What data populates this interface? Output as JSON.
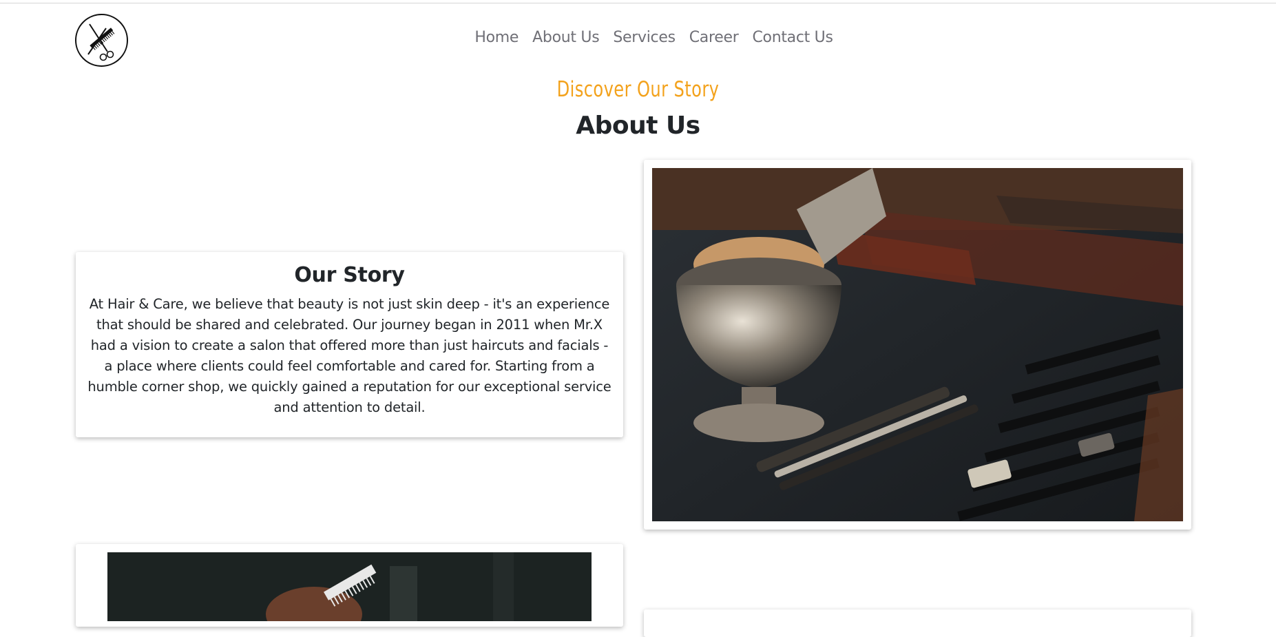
{
  "nav": {
    "items": [
      "Home",
      "About Us",
      "Services",
      "Career",
      "Contact Us"
    ]
  },
  "header": {
    "eyebrow": "Discover Our Story",
    "title": "About Us"
  },
  "story": {
    "heading": "Our Story",
    "body": "At Hair & Care, we believe that beauty is not just skin deep - it's an experience that should be shared and celebrated. Our journey began in 2011 when Mr.X had a vision to create a salon that offered more than just haircuts and facials - a place where clients could feel comfortable and cared for. Starting from a humble corner shop, we quickly gained a reputation for our exceptional service and attention to detail."
  },
  "colors": {
    "accent": "#f3a21c",
    "nav_text": "#6f6f76",
    "heading": "#212529"
  },
  "icons": {
    "logo": "scissors-comb-logo-icon"
  }
}
